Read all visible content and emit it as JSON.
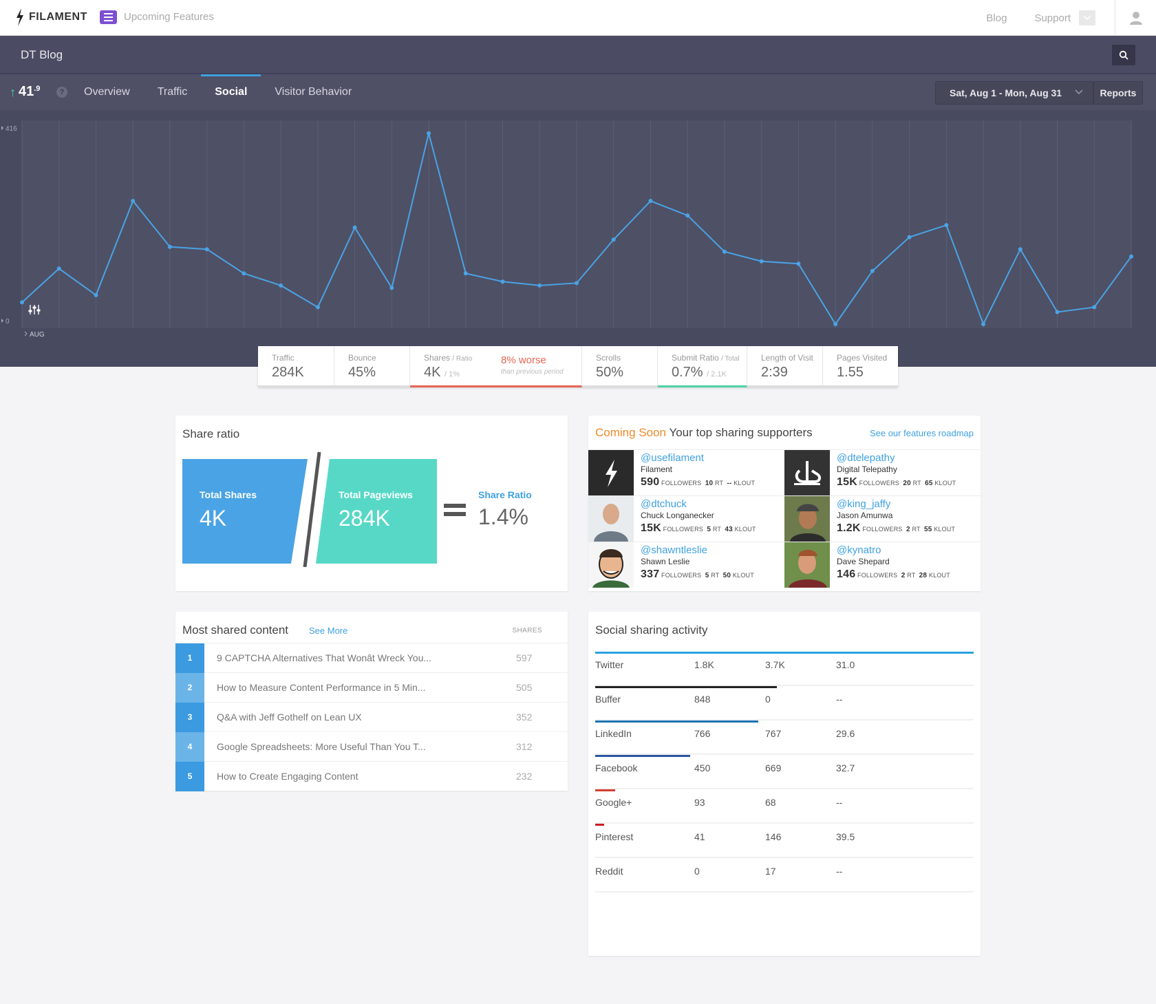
{
  "topbar": {
    "brand": "FILAMENT",
    "upcoming": "Upcoming Features",
    "links": [
      "Blog",
      "Support"
    ]
  },
  "site": {
    "name": "DT Blog"
  },
  "nav": {
    "score": "41",
    "score_decimal": ".9",
    "help": "?",
    "tabs": [
      "Overview",
      "Traffic",
      "Social",
      "Visitor Behavior"
    ],
    "active_tab": "Social",
    "date_range": "Sat, Aug 1 - Mon, Aug 31",
    "reports": "Reports"
  },
  "chart_data": {
    "type": "line",
    "x": [
      1,
      2,
      3,
      4,
      5,
      6,
      7,
      8,
      9,
      10,
      11,
      12,
      13,
      14,
      15,
      16,
      17,
      18,
      19,
      20,
      21,
      22,
      23,
      24,
      25,
      26,
      27,
      28,
      29,
      30,
      31
    ],
    "values": [
      45,
      115,
      60,
      255,
      160,
      155,
      105,
      80,
      35,
      200,
      75,
      395,
      105,
      88,
      80,
      85,
      175,
      255,
      225,
      150,
      130,
      125,
      0,
      110,
      180,
      205,
      0,
      155,
      25,
      35,
      140
    ],
    "ylim": [
      0,
      416
    ],
    "ytick_labels": [
      "416",
      "0"
    ],
    "xlabel": "AUG",
    "color": "#4aa3e4"
  },
  "metrics": [
    {
      "label": "Traffic",
      "label_suffix": "",
      "value": "284K",
      "value_suffix": ""
    },
    {
      "label": "Bounce",
      "label_suffix": "",
      "value": "45%",
      "value_suffix": ""
    },
    {
      "label": "Shares",
      "label_suffix": "/ Ratio",
      "value": "4K",
      "value_suffix": "/ 1%"
    },
    {
      "label": "Scrolls",
      "label_suffix": "",
      "value": "50%",
      "value_suffix": ""
    },
    {
      "label": "Submit Ratio",
      "label_suffix": "/ Total",
      "value": "0.7%",
      "value_suffix": "/ 2.1K"
    },
    {
      "label": "Length of Visit",
      "label_suffix": "",
      "value": "2:39",
      "value_suffix": ""
    },
    {
      "label": "Pages Visited",
      "label_suffix": "",
      "value": "1.55",
      "value_suffix": ""
    }
  ],
  "comparison": {
    "pct": "8% worse",
    "sub": "than previous period"
  },
  "share_ratio": {
    "title": "Share ratio",
    "total_shares_label": "Total Shares",
    "total_shares": "4K",
    "total_pageviews_label": "Total Pageviews",
    "total_pageviews": "284K",
    "ratio_label": "Share Ratio",
    "ratio": "1.4%"
  },
  "supporters": {
    "coming_soon": "Coming Soon",
    "title": "Your top sharing supporters",
    "roadmap": "See our features roadmap",
    "followers_label": "FOLLOWERS",
    "rt_label": "RT",
    "klout_label": "KLOUT",
    "people": [
      {
        "handle": "@usefilament",
        "name": "Filament",
        "followers": "590",
        "rt": "10",
        "klout": "--"
      },
      {
        "handle": "@dtelepathy",
        "name": "Digital Telepathy",
        "followers": "15K",
        "rt": "20",
        "klout": "65"
      },
      {
        "handle": "@dtchuck",
        "name": "Chuck Longanecker",
        "followers": "15K",
        "rt": "5",
        "klout": "43"
      },
      {
        "handle": "@king_jaffy",
        "name": "Jason Amunwa",
        "followers": "1.2K",
        "rt": "2",
        "klout": "55"
      },
      {
        "handle": "@shawntleslie",
        "name": "Shawn Leslie",
        "followers": "337",
        "rt": "5",
        "klout": "50"
      },
      {
        "handle": "@kynatro",
        "name": "Dave Shepard",
        "followers": "146",
        "rt": "2",
        "klout": "28"
      }
    ]
  },
  "most_shared": {
    "title": "Most shared content",
    "see_more": "See More",
    "shares_header": "SHARES",
    "items": [
      {
        "rank": "1",
        "title": "9 CAPTCHA Alternatives That Wonât Wreck You...",
        "shares": "597"
      },
      {
        "rank": "2",
        "title": "How to Measure Content Performance in 5 Min...",
        "shares": "505"
      },
      {
        "rank": "3",
        "title": "Q&A with Jeff Gothelf on Lean UX",
        "shares": "352"
      },
      {
        "rank": "4",
        "title": "Google Spreadsheets: More Useful Than You T...",
        "shares": "312"
      },
      {
        "rank": "5",
        "title": "How to Create Engaging Content",
        "shares": "232"
      }
    ]
  },
  "social_activity": {
    "title": "Social sharing activity",
    "networks": [
      {
        "name": "Twitter",
        "a": "1.8K",
        "b": "3.7K",
        "c": "31.0",
        "bar": 1.0,
        "color": "#2ba1e4"
      },
      {
        "name": "Buffer",
        "a": "848",
        "b": "0",
        "c": "--",
        "bar": 0.48,
        "color": "#222222"
      },
      {
        "name": "LinkedIn",
        "a": "766",
        "b": "767",
        "c": "29.6",
        "bar": 0.43,
        "color": "#1d73b3"
      },
      {
        "name": "Facebook",
        "a": "450",
        "b": "669",
        "c": "32.7",
        "bar": 0.25,
        "color": "#2b56a3"
      },
      {
        "name": "Google+",
        "a": "93",
        "b": "68",
        "c": "--",
        "bar": 0.052,
        "color": "#d23f31"
      },
      {
        "name": "Pinterest",
        "a": "41",
        "b": "146",
        "c": "39.5",
        "bar": 0.023,
        "color": "#cb2027"
      },
      {
        "name": "Reddit",
        "a": "0",
        "b": "17",
        "c": "--",
        "bar": 0,
        "color": "#ff4500"
      }
    ]
  }
}
